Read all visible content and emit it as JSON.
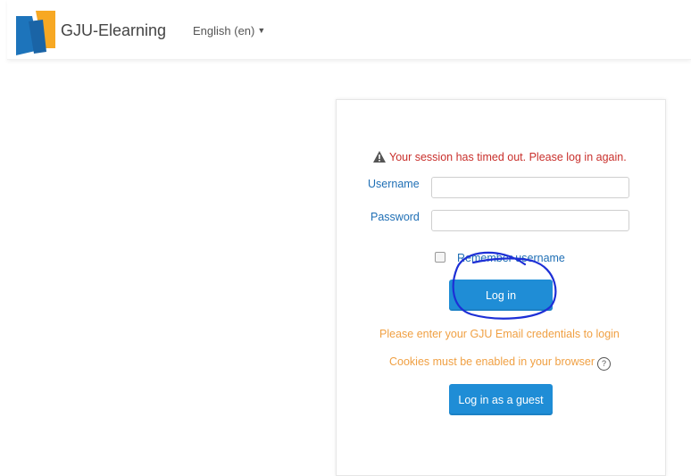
{
  "header": {
    "site_name": "GJU-Elearning",
    "language": "English (en)"
  },
  "login": {
    "error_message": "Your session has timed out. Please log in again.",
    "username_label": "Username",
    "username_value": "",
    "password_label": "Password",
    "password_value": "",
    "remember_label": "Remember username",
    "login_button": "Log in",
    "credentials_note": "Please enter your GJU Email credentials to login",
    "cookies_note": "Cookies must be enabled in your browser",
    "guest_button": "Log in as a guest"
  },
  "colors": {
    "primary": "#1f8dd6",
    "error": "#c9302c",
    "note": "#f0a043",
    "logo_orange": "#f7a823",
    "logo_blue": "#1d74bb"
  }
}
